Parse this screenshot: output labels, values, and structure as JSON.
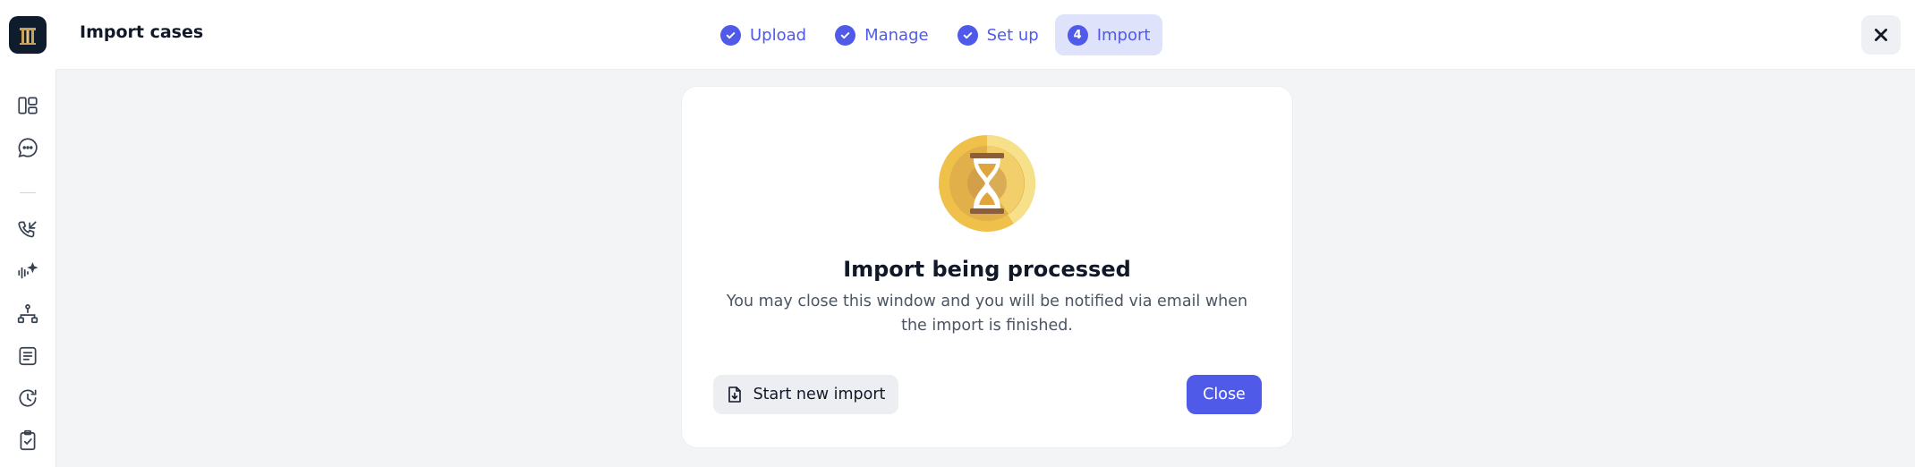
{
  "header": {
    "title": "Import cases",
    "steps": [
      {
        "label": "Upload",
        "state": "done"
      },
      {
        "label": "Manage",
        "state": "done"
      },
      {
        "label": "Set up",
        "state": "done"
      },
      {
        "label": "Import",
        "number": "4",
        "state": "active"
      }
    ]
  },
  "sidebar": {
    "items": [
      {
        "icon": "dashboard-icon"
      },
      {
        "icon": "chat-icon"
      },
      {
        "icon": "phone-incoming-icon"
      },
      {
        "icon": "voice-ai-icon"
      },
      {
        "icon": "workflow-icon"
      },
      {
        "icon": "document-icon"
      },
      {
        "icon": "history-icon"
      },
      {
        "icon": "clipboard-check-icon"
      }
    ]
  },
  "dialog": {
    "icon": "hourglass-icon",
    "title": "Import being processed",
    "message": "You may close this window and you will be notified via email when the import is finished.",
    "secondary_button": "Start new import",
    "primary_button": "Close"
  },
  "colors": {
    "accent": "#4f5be8",
    "step_active_bg": "#dfe2fb",
    "background": "#f3f4f6"
  }
}
